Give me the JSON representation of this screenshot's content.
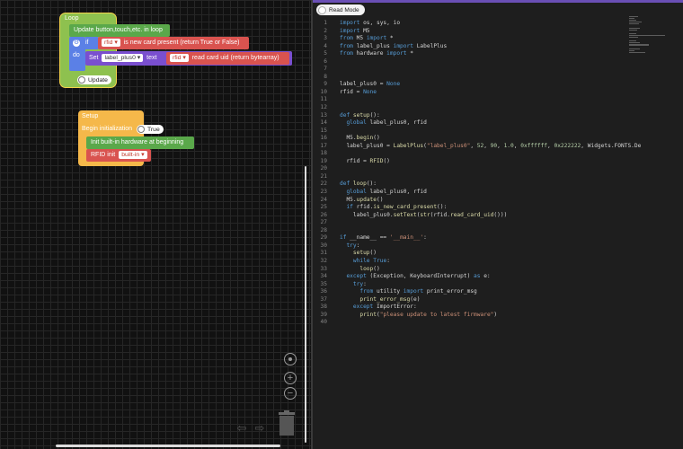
{
  "editor": {
    "read_mode_label": "Read Mode",
    "lines": [
      {
        "n": "1",
        "html": "<span class='kw'>import</span> os, sys, io"
      },
      {
        "n": "2",
        "html": "<span class='kw'>import</span> M5"
      },
      {
        "n": "3",
        "html": "<span class='kw'>from</span> M5 <span class='kw'>import</span> *"
      },
      {
        "n": "4",
        "html": "<span class='kw'>from</span> label_plus <span class='kw'>import</span> LabelPlus"
      },
      {
        "n": "5",
        "html": "<span class='kw'>from</span> hardware <span class='kw'>import</span> *"
      },
      {
        "n": "6",
        "html": ""
      },
      {
        "n": "7",
        "html": ""
      },
      {
        "n": "8",
        "html": ""
      },
      {
        "n": "9",
        "html": "label_plus0 = <span class='kw'>None</span>"
      },
      {
        "n": "10",
        "html": "rfid = <span class='kw'>None</span>"
      },
      {
        "n": "11",
        "html": ""
      },
      {
        "n": "12",
        "html": ""
      },
      {
        "n": "13",
        "html": "<span class='kw'>def</span> <span class='fn'>setup</span>():"
      },
      {
        "n": "14",
        "html": "  <span class='kw'>global</span> label_plus0, rfid"
      },
      {
        "n": "15",
        "html": ""
      },
      {
        "n": "16",
        "html": "  M5.<span class='fn'>begin</span>()"
      },
      {
        "n": "17",
        "html": "  label_plus0 = <span class='fn'>LabelPlus</span>(<span class='st'>\"label_plus0\"</span>, <span class='nb'>52</span>, <span class='nb'>90</span>, <span class='nb'>1.0</span>, <span class='nb'>0xffffff</span>, <span class='nb'>0x222222</span>, Widgets.FONTS.De"
      },
      {
        "n": "18",
        "html": ""
      },
      {
        "n": "19",
        "html": "  rfid = <span class='fn'>RFID</span>()"
      },
      {
        "n": "20",
        "html": ""
      },
      {
        "n": "21",
        "html": ""
      },
      {
        "n": "22",
        "html": "<span class='kw'>def</span> <span class='fn'>loop</span>():"
      },
      {
        "n": "23",
        "html": "  <span class='kw'>global</span> label_plus0, rfid"
      },
      {
        "n": "24",
        "html": "  M5.<span class='fn'>update</span>()"
      },
      {
        "n": "25",
        "html": "  <span class='kw'>if</span> rfid.<span class='fn'>is_new_card_present</span>():"
      },
      {
        "n": "26",
        "html": "    label_plus0.<span class='fn'>setText</span>(<span class='fn'>str</span>(rfid.<span class='fn'>read_card_uid</span>()))"
      },
      {
        "n": "27",
        "html": ""
      },
      {
        "n": "28",
        "html": ""
      },
      {
        "n": "29",
        "html": "<span class='kw'>if</span> __name__ == <span class='st'>'__main__'</span>:"
      },
      {
        "n": "30",
        "html": "  <span class='kw'>try</span>:"
      },
      {
        "n": "31",
        "html": "    <span class='fn'>setup</span>()"
      },
      {
        "n": "32",
        "html": "    <span class='kw'>while</span> <span class='kw'>True</span>:"
      },
      {
        "n": "33",
        "html": "      <span class='fn'>loop</span>()"
      },
      {
        "n": "34",
        "html": "  <span class='kw'>except</span> (Exception, KeyboardInterrupt) <span class='kw'>as</span> e:"
      },
      {
        "n": "35",
        "html": "    <span class='kw'>try</span>:"
      },
      {
        "n": "36",
        "html": "      <span class='kw'>from</span> utility <span class='kw'>import</span> print_error_msg"
      },
      {
        "n": "37",
        "html": "      <span class='fn'>print_error_msg</span>(e)"
      },
      {
        "n": "38",
        "html": "    <span class='kw'>except</span> ImportError:"
      },
      {
        "n": "39",
        "html": "      <span class='fn'>print</span>(<span class='st'>\"please update to latest firmware\"</span>)"
      },
      {
        "n": "40",
        "html": ""
      }
    ]
  },
  "blocks": {
    "loop": {
      "label": "Loop",
      "update_label": "Update button,touch,etc. in loop",
      "if_label": "if",
      "do_label": "do",
      "rfid_field": "rfid",
      "new_card_label": "is new card present (return True or False)",
      "set_label": "Set",
      "label_field": "label_plus0",
      "text_label": "text",
      "read_uid_label": "read card uid (return bytearray)",
      "update_switch_label": "Update"
    },
    "setup": {
      "label": "Setup",
      "begin_label": "Begin initialization",
      "begin_switch_label": "True",
      "init_hw_label": "Init built-in hardware at beginning",
      "rfid_init_label": "RFID init",
      "rfid_init_field": "built-in"
    }
  },
  "icons": {
    "recenter": "crosshair-icon",
    "zoom_in": "plus-icon",
    "zoom_out": "minus-icon",
    "undo": "undo-arrow-icon",
    "redo": "redo-arrow-icon",
    "trash": "trash-icon",
    "gear": "gear-icon",
    "dropdown": "chevron-down-icon"
  },
  "colors": {
    "loop_block": "#8ec14f",
    "event_block": "#5aa84a",
    "if_block": "#5b80e6",
    "rfid_block": "#d9534f",
    "set_block": "#7a4fcf",
    "setup_block": "#f5b84a",
    "accent_bar": "#6a4fb5"
  }
}
